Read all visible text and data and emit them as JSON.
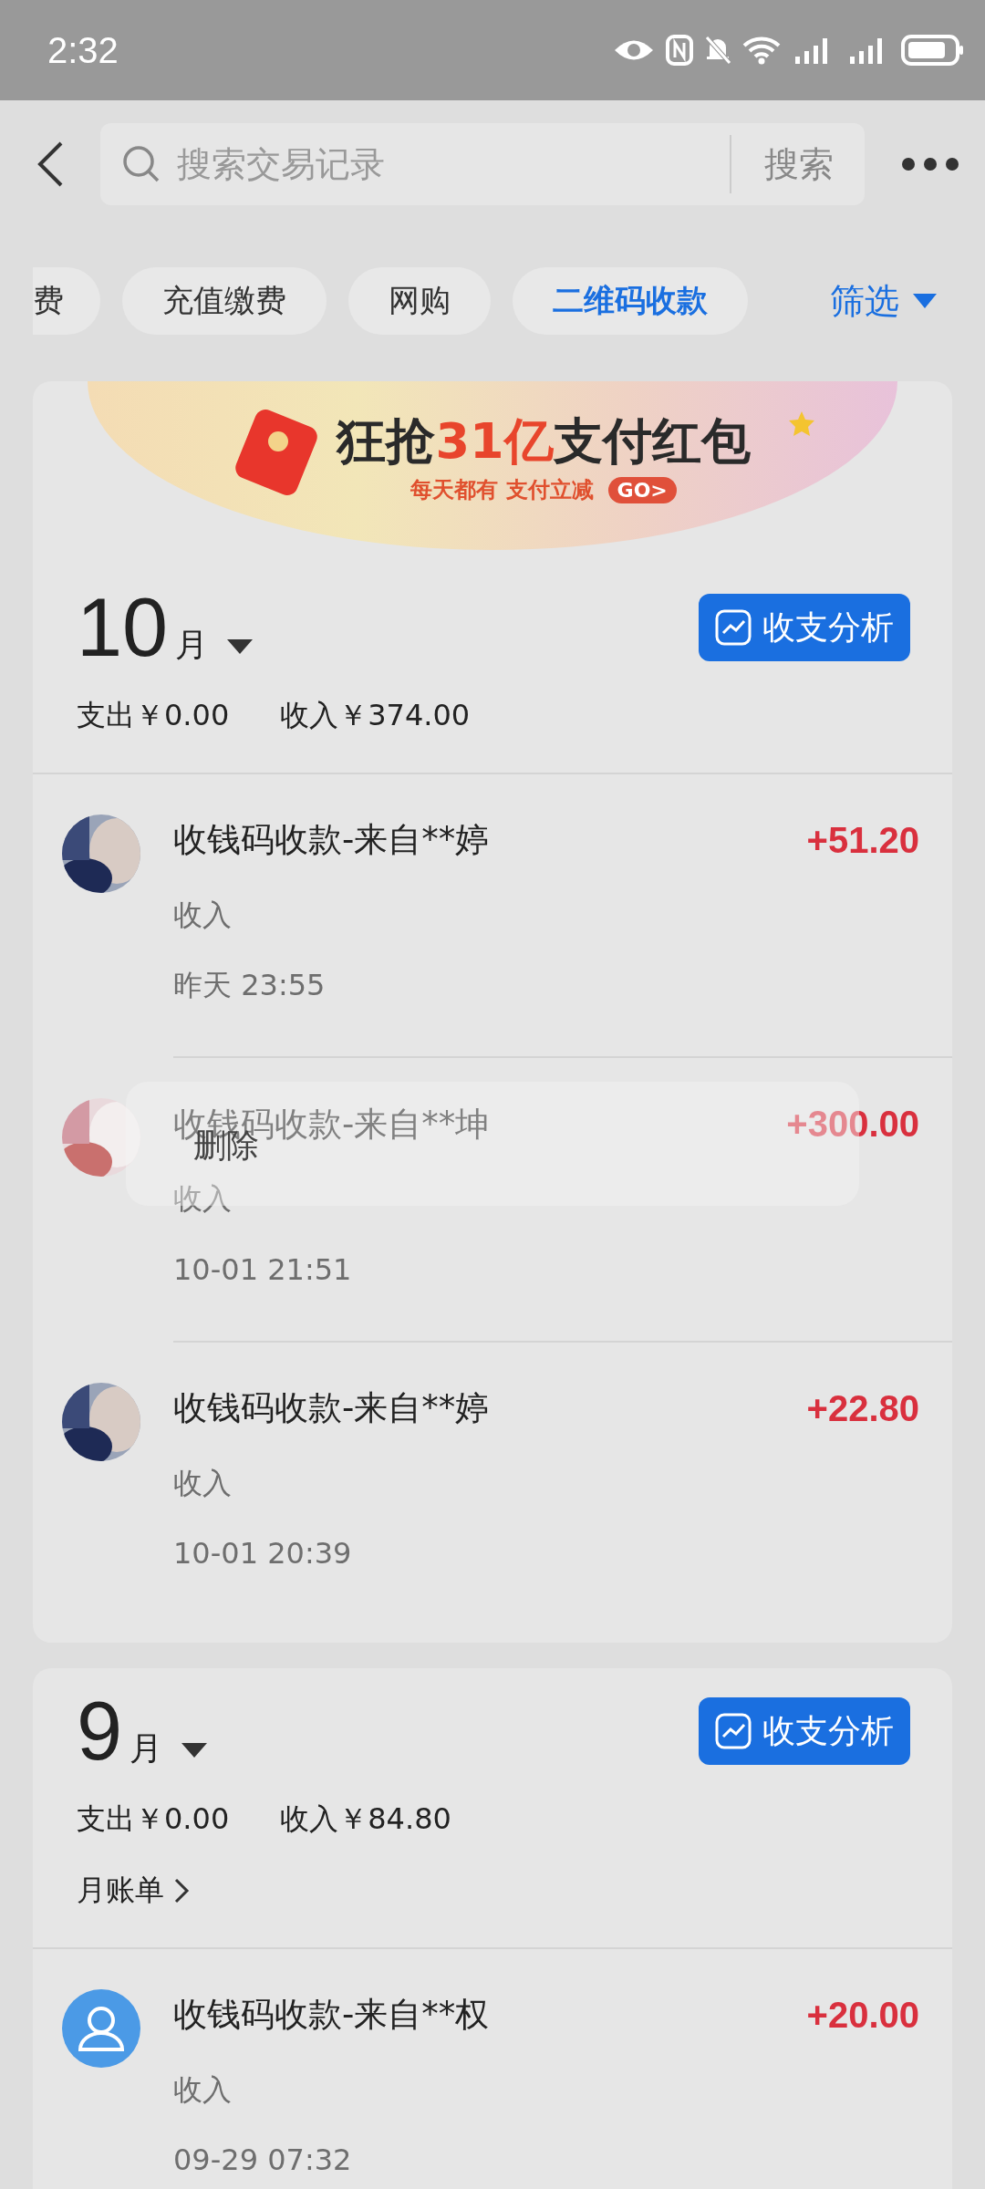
{
  "status_bar": {
    "time": "2:32"
  },
  "header": {
    "search": {
      "placeholder": "搜索交易记录"
    },
    "search_button": "搜索"
  },
  "chips": [
    {
      "label": "费",
      "selected": false
    },
    {
      "label": "充值缴费",
      "selected": false
    },
    {
      "label": "网购",
      "selected": false
    },
    {
      "label": "二维码收款",
      "selected": true
    }
  ],
  "filter": "筛选",
  "banner": {
    "title_before": "狂抢",
    "title_highlight": "31亿",
    "title_after": "支付红包",
    "subtitle": "每天都有 支付立减",
    "go": "GO>"
  },
  "months": [
    {
      "month": "10",
      "unit": "月",
      "analysis": "收支分析",
      "expense": "支出￥0.00",
      "income": "收入￥374.00",
      "transactions": [
        {
          "title": "收钱码收款-来自**婷",
          "type": "收入",
          "time": "昨天 23:55",
          "amount": "+51.20",
          "kind": "picture"
        },
        {
          "title": "收钱码收款-来自**坤",
          "type": "收入",
          "time": "10-01 21:51",
          "amount": "+300.00",
          "kind": "picture"
        },
        {
          "title": "收钱码收款-来自**婷",
          "type": "收入",
          "time": "10-01 20:39",
          "amount": "+22.80",
          "kind": "picture"
        }
      ]
    },
    {
      "month": "9",
      "unit": "月",
      "analysis": "收支分析",
      "expense": "支出￥0.00",
      "income": "收入￥84.80",
      "bill_link": "月账单",
      "transactions": [
        {
          "title": "收钱码收款-来自**权",
          "type": "收入",
          "time": "09-29 07:32",
          "amount": "+20.00",
          "kind": "person"
        }
      ]
    }
  ],
  "context_menu": {
    "items": [
      "删除"
    ]
  }
}
